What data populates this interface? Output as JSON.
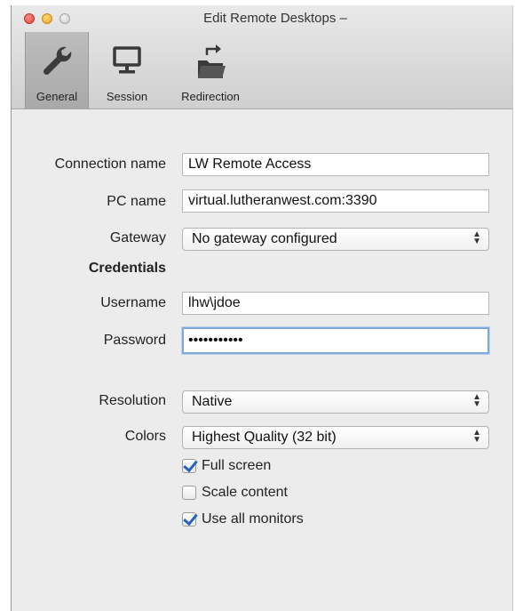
{
  "window": {
    "title": "Edit Remote Desktops –"
  },
  "toolbar": {
    "general": {
      "label": "General",
      "icon": "wrench-icon"
    },
    "session": {
      "label": "Session",
      "icon": "monitor-icon"
    },
    "redirection": {
      "label": "Redirection",
      "icon": "folder-redirect-icon"
    }
  },
  "form": {
    "connection_name": {
      "label": "Connection name",
      "value": "LW Remote Access"
    },
    "pc_name": {
      "label": "PC name",
      "value": "virtual.lutheranwest.com:3390"
    },
    "gateway": {
      "label": "Gateway",
      "value": "No gateway configured"
    },
    "credentials_heading": "Credentials",
    "username": {
      "label": "Username",
      "value": "lhw\\jdoe"
    },
    "password": {
      "label": "Password",
      "value": "•••••••••••"
    },
    "resolution": {
      "label": "Resolution",
      "value": "Native"
    },
    "colors": {
      "label": "Colors",
      "value": "Highest Quality (32 bit)"
    },
    "options": [
      {
        "label": "Full screen",
        "checked": true
      },
      {
        "label": "Scale content",
        "checked": false
      },
      {
        "label": "Use all monitors",
        "checked": true
      }
    ]
  }
}
